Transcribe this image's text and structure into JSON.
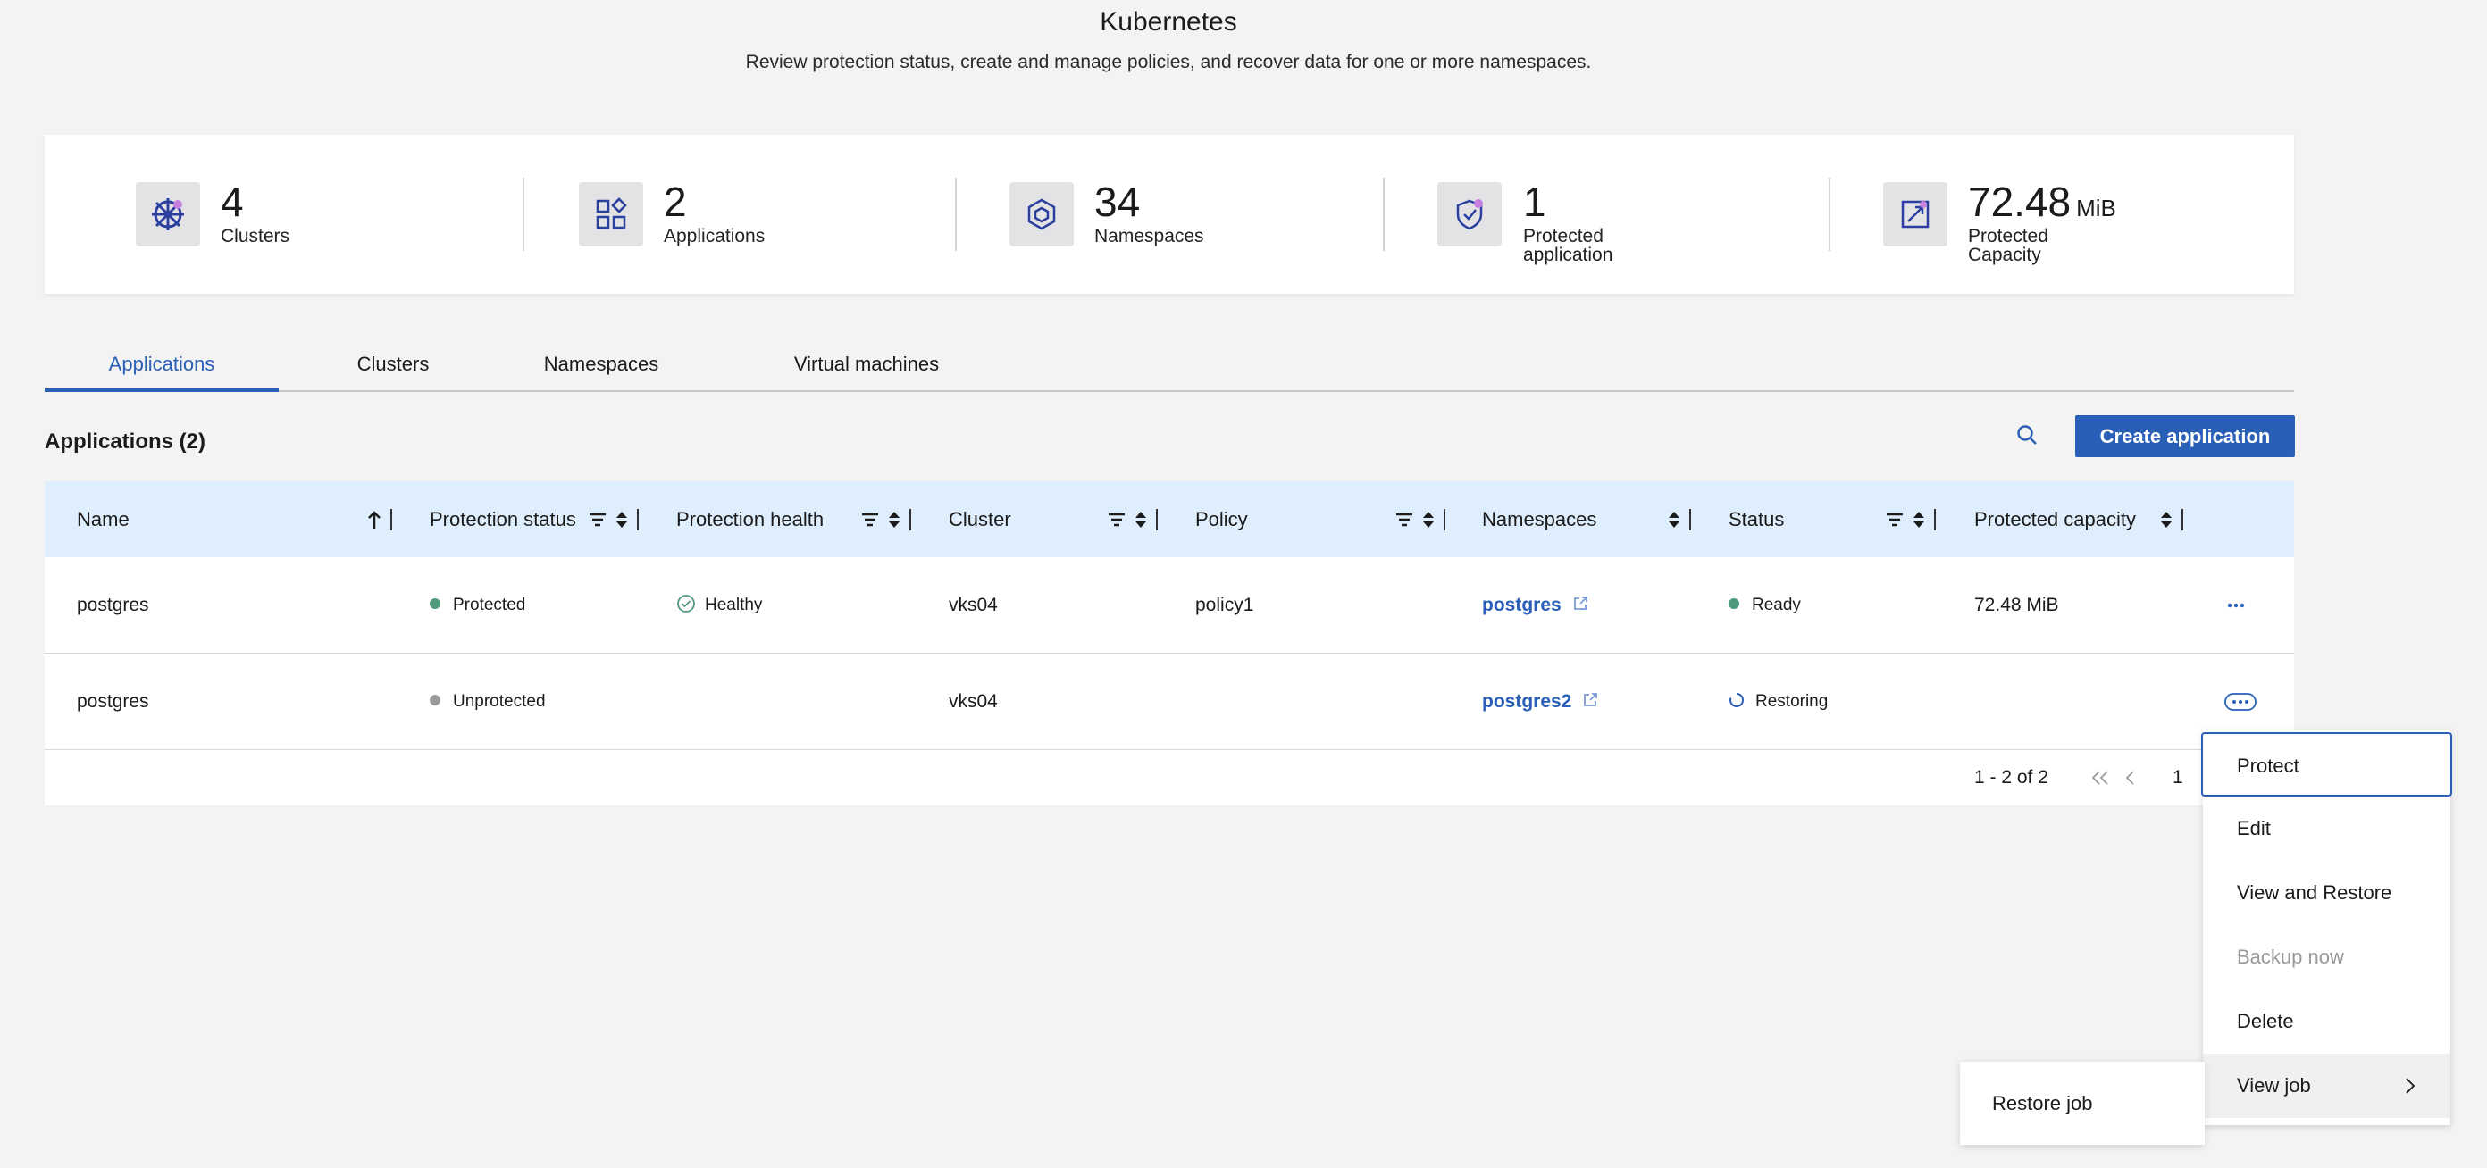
{
  "header": {
    "title": "Kubernetes",
    "subtitle": "Review protection status, create and manage policies, and recover data for one or more namespaces."
  },
  "summary": [
    {
      "value": "4",
      "unit": "",
      "label": "Clusters",
      "icon": "kubernetes-wheel-icon"
    },
    {
      "value": "2",
      "unit": "",
      "label": "Applications",
      "icon": "applications-grid-icon"
    },
    {
      "value": "34",
      "unit": "",
      "label": "Namespaces",
      "icon": "namespace-cube-icon"
    },
    {
      "value": "1",
      "unit": "",
      "label": "Protected application",
      "icon": "shield-icon"
    },
    {
      "value": "72.48",
      "unit": "MiB",
      "label": "Protected Capacity",
      "icon": "capacity-expand-icon"
    }
  ],
  "tabs": [
    {
      "label": "Applications",
      "active": true
    },
    {
      "label": "Clusters",
      "active": false
    },
    {
      "label": "Namespaces",
      "active": false
    },
    {
      "label": "Virtual machines",
      "active": false
    }
  ],
  "section": {
    "title": "Applications (2)",
    "create_label": "Create application"
  },
  "table": {
    "columns": [
      "Name",
      "Protection status",
      "Protection health",
      "Cluster",
      "Policy",
      "Namespaces",
      "Status",
      "Protected capacity"
    ],
    "rows": [
      {
        "name": "postgres",
        "protection_status": "Protected",
        "protection_health": "Healthy",
        "cluster": "vks04",
        "policy": "policy1",
        "namespace": "postgres",
        "status": "Ready",
        "capacity": "72.48 MiB"
      },
      {
        "name": "postgres",
        "protection_status": "Unprotected",
        "protection_health": "",
        "cluster": "vks04",
        "policy": "",
        "namespace": "postgres2",
        "status": "Restoring",
        "capacity": ""
      }
    ],
    "pagination": {
      "range": "1 - 2 of 2",
      "page": "1"
    }
  },
  "menu": {
    "items": [
      {
        "label": "Protect",
        "state": "focused"
      },
      {
        "label": "Edit",
        "state": "normal"
      },
      {
        "label": "View and Restore",
        "state": "normal"
      },
      {
        "label": "Backup now",
        "state": "disabled"
      },
      {
        "label": "Delete",
        "state": "normal"
      },
      {
        "label": "View job",
        "state": "hover"
      }
    ],
    "submenu": [
      {
        "label": "Restore job"
      }
    ]
  },
  "colors": {
    "accent": "#2a5fb8",
    "protected": "#4f9a7c",
    "unprotected": "#9a9a9a",
    "ready": "#4f9a7c",
    "header_row": "#dfeefd"
  }
}
